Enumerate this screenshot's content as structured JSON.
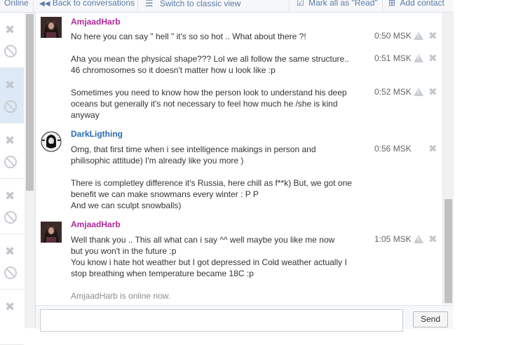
{
  "topbar": {
    "online": "Online",
    "back": "Back to conversations",
    "classic": "Switch to classic view",
    "mark_read": "Mark all as \"Read\"",
    "add_contact": "Add contact"
  },
  "messages": [
    {
      "author": "AmjaadHarb",
      "lines": [
        {
          "text": "No here you can say \" hell \" it's so so hot .. What about there ?!",
          "time": "0:50 MSK"
        },
        {
          "text": "Aha you mean the physical shape??? Lol we all follow the same structure..\n46 chromosomes so it doesn't matter how u look like :p",
          "time": "0:51 MSK"
        },
        {
          "text": "Sometimes you need to know how the person look to understand his deep\noceans but generally it's not necessary to feel how much he /she is kind\nanyway",
          "time": "0:52 MSK"
        }
      ]
    },
    {
      "author": "DarkLigthing",
      "lines": [
        {
          "text": "Omg, that first time when i see intelligence makings in person and\nphilisophic attitude) I'm already like you more )",
          "time": "0:56 MSK"
        },
        {
          "text": "There is completley difference it's Russia, here chill as f**k) But, we got one\nbenefit we can make snowmans every winter : P P\nAnd we can sculpt snowballs)",
          "time": ""
        }
      ]
    },
    {
      "author": "AmjaadHarb",
      "lines": [
        {
          "text": "Well thank you .. This all what can i say ^^ well maybe you like me now\nbut you won't in the future :p\nYou know i hate hot weather but I got depressed in Cold weather actually I\nstop breathing when temperature became 18C :p",
          "time": "1:05 MSK"
        }
      ]
    }
  ],
  "status": "AmjaadHarb is online now.",
  "send_label": "Send",
  "colors": {
    "author_female": "#b0299b",
    "author_male": "#2a6ab5",
    "link": "#5b7ba8"
  }
}
